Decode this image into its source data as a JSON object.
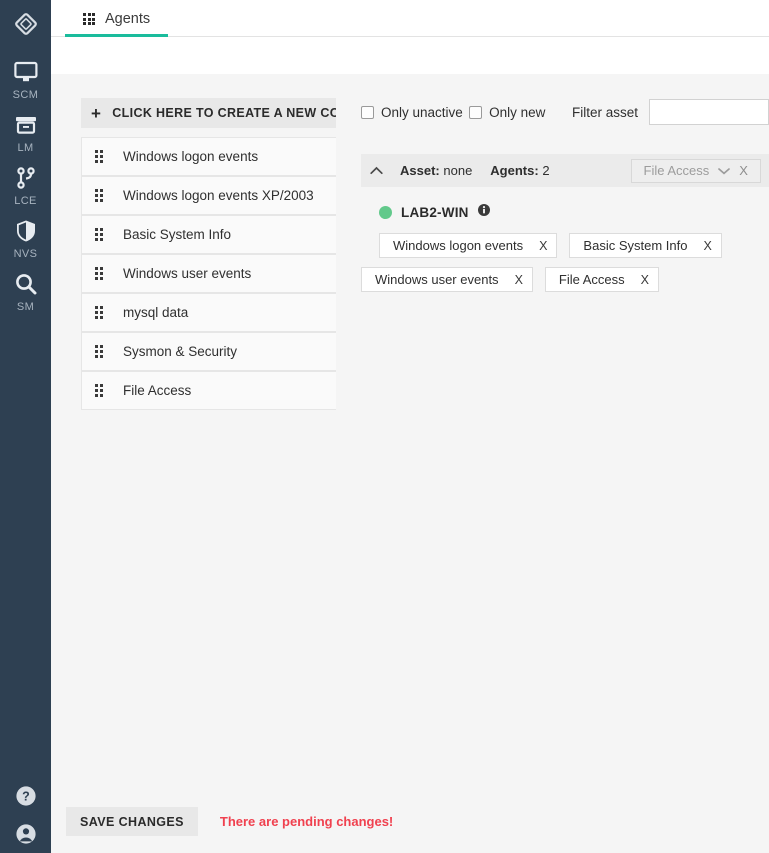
{
  "sidebar": {
    "logo": "diamond-logo",
    "items": [
      {
        "label": "SCM",
        "icon": "monitor-icon"
      },
      {
        "label": "LM",
        "icon": "archive-box-icon"
      },
      {
        "label": "LCE",
        "icon": "branch-icon"
      },
      {
        "label": "NVS",
        "icon": "shield-icon"
      },
      {
        "label": "SM",
        "icon": "magnifier-icon"
      }
    ],
    "bottom": [
      {
        "icon": "help-icon"
      },
      {
        "icon": "user-account-icon"
      }
    ]
  },
  "topbar": {
    "tab_label": "Agents",
    "tab_icon": "grid-icon",
    "accent_color": "#1abc9c"
  },
  "configurations": {
    "create_button": "CLICK HERE TO CREATE A NEW CONFIGURATION",
    "items": [
      {
        "name": "Windows logon events"
      },
      {
        "name": "Windows logon events XP/2003"
      },
      {
        "name": "Basic System Info"
      },
      {
        "name": "Windows user events"
      },
      {
        "name": "mysql data"
      },
      {
        "name": "Sysmon & Security"
      },
      {
        "name": "File Access"
      }
    ]
  },
  "filters": {
    "only_unactive_label": "Only unactive",
    "only_unactive_checked": false,
    "only_new_label": "Only new",
    "only_new_checked": false,
    "filter_asset_label": "Filter asset",
    "filter_asset_value": "",
    "filter_asset_placeholder": ""
  },
  "asset_group": {
    "collapse_icon": "chevron-up-icon",
    "asset_label": "Asset:",
    "asset_value": "none",
    "agents_label": "Agents:",
    "agents_value": "2",
    "dropdown_value": "File Access",
    "dropdown_chevron": "chevron-down-icon",
    "dropdown_clear": "X"
  },
  "agents": [
    {
      "name": "LAB2-WIN",
      "status_color": "#62c98b",
      "info_icon": "info-icon",
      "configs": [
        {
          "label": "Windows logon events",
          "remove": "X"
        },
        {
          "label": "Basic System Info",
          "remove": "X"
        },
        {
          "label": "Windows user events",
          "remove": "X"
        },
        {
          "label": "File Access",
          "remove": "X"
        }
      ]
    }
  ],
  "bottombar": {
    "save_label": "SAVE CHANGES",
    "pending_message": "There are pending changes!",
    "pending_color": "#f0414f"
  }
}
